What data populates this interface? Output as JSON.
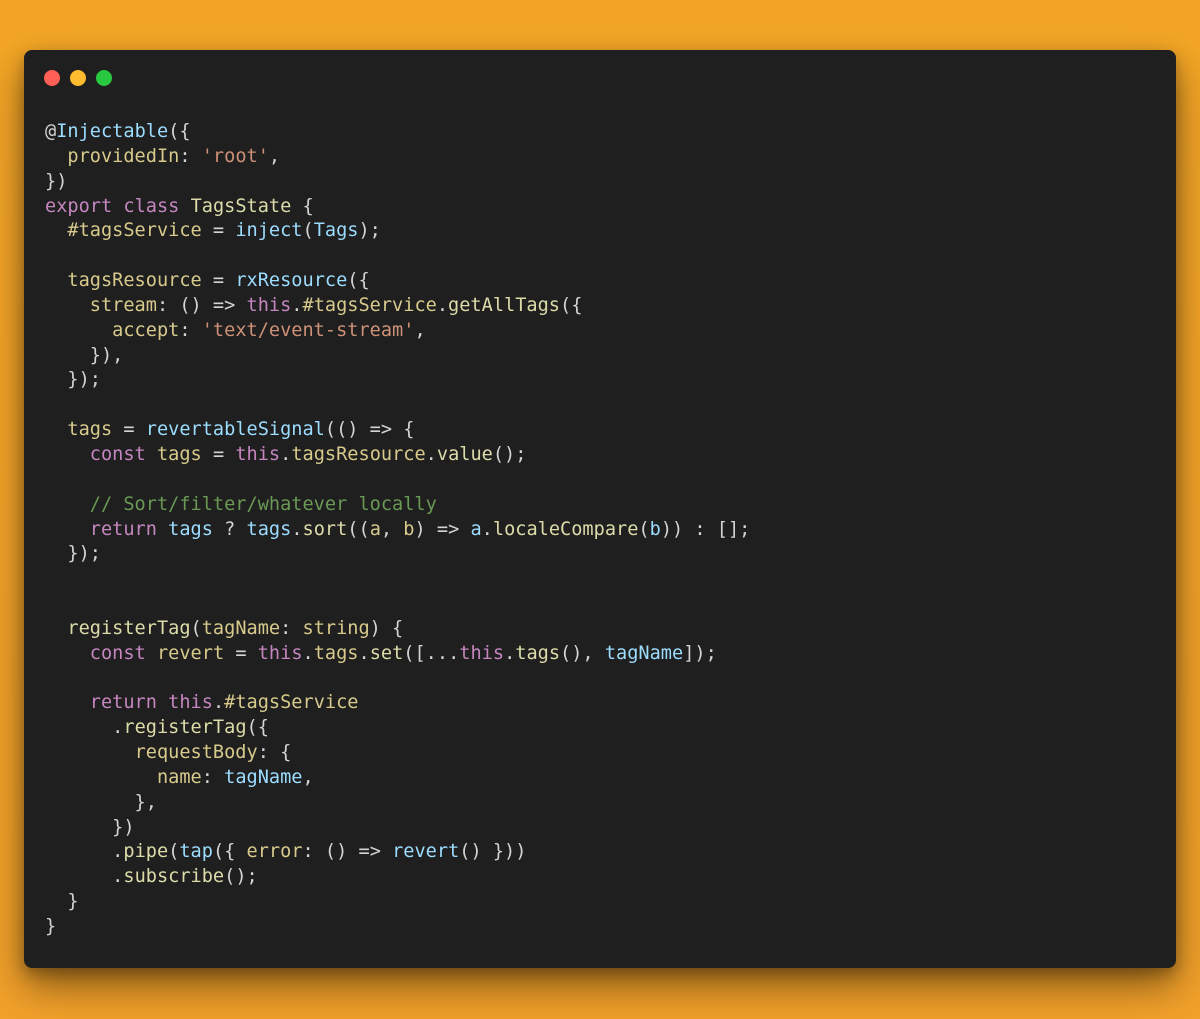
{
  "window": {
    "controls": [
      "close-icon",
      "minimize-icon",
      "maximize-icon"
    ],
    "colors": {
      "close": "#ff5f57",
      "minimize": "#febc2e",
      "maximize": "#28c840",
      "background": "#1f1f1f",
      "page": "#f3a626"
    }
  },
  "code": {
    "lines": [
      [
        [
          "plain",
          "@"
        ],
        [
          "var",
          "Injectable"
        ],
        [
          "plain",
          "({"
        ]
      ],
      [
        [
          "plain",
          "  "
        ],
        [
          "prop",
          "providedIn"
        ],
        [
          "plain",
          ": "
        ],
        [
          "string",
          "'root'"
        ],
        [
          "plain",
          ","
        ]
      ],
      [
        [
          "plain",
          "})"
        ]
      ],
      [
        [
          "keyword",
          "export"
        ],
        [
          "plain",
          " "
        ],
        [
          "keyword",
          "class"
        ],
        [
          "plain",
          " "
        ],
        [
          "fn",
          "TagsState"
        ],
        [
          "plain",
          " {"
        ]
      ],
      [
        [
          "plain",
          "  "
        ],
        [
          "prop",
          "#tagsService"
        ],
        [
          "plain",
          " = "
        ],
        [
          "var",
          "inject"
        ],
        [
          "plain",
          "("
        ],
        [
          "var",
          "Tags"
        ],
        [
          "plain",
          ");"
        ]
      ],
      [],
      [
        [
          "plain",
          "  "
        ],
        [
          "prop",
          "tagsResource"
        ],
        [
          "plain",
          " = "
        ],
        [
          "var",
          "rxResource"
        ],
        [
          "plain",
          "({"
        ]
      ],
      [
        [
          "plain",
          "    "
        ],
        [
          "prop",
          "stream"
        ],
        [
          "plain",
          ": () => "
        ],
        [
          "keyword",
          "this"
        ],
        [
          "plain",
          "."
        ],
        [
          "prop",
          "#tagsService"
        ],
        [
          "plain",
          "."
        ],
        [
          "fn",
          "getAllTags"
        ],
        [
          "plain",
          "({"
        ]
      ],
      [
        [
          "plain",
          "      "
        ],
        [
          "prop",
          "accept"
        ],
        [
          "plain",
          ": "
        ],
        [
          "string",
          "'text/event-stream'"
        ],
        [
          "plain",
          ","
        ]
      ],
      [
        [
          "plain",
          "    }),"
        ]
      ],
      [
        [
          "plain",
          "  });"
        ]
      ],
      [],
      [
        [
          "plain",
          "  "
        ],
        [
          "prop",
          "tags"
        ],
        [
          "plain",
          " = "
        ],
        [
          "var",
          "revertableSignal"
        ],
        [
          "plain",
          "(() => {"
        ]
      ],
      [
        [
          "plain",
          "    "
        ],
        [
          "keyword",
          "const"
        ],
        [
          "plain",
          " "
        ],
        [
          "prop",
          "tags"
        ],
        [
          "plain",
          " = "
        ],
        [
          "keyword",
          "this"
        ],
        [
          "plain",
          "."
        ],
        [
          "prop",
          "tagsResource"
        ],
        [
          "plain",
          "."
        ],
        [
          "fn",
          "value"
        ],
        [
          "plain",
          "();"
        ]
      ],
      [],
      [
        [
          "plain",
          "    "
        ],
        [
          "comment",
          "// Sort/filter/whatever locally"
        ]
      ],
      [
        [
          "plain",
          "    "
        ],
        [
          "keyword",
          "return"
        ],
        [
          "plain",
          " "
        ],
        [
          "var",
          "tags"
        ],
        [
          "plain",
          " ? "
        ],
        [
          "var",
          "tags"
        ],
        [
          "plain",
          "."
        ],
        [
          "fn",
          "sort"
        ],
        [
          "plain",
          "(("
        ],
        [
          "prop",
          "a"
        ],
        [
          "plain",
          ", "
        ],
        [
          "prop",
          "b"
        ],
        [
          "plain",
          ") => "
        ],
        [
          "var",
          "a"
        ],
        [
          "plain",
          "."
        ],
        [
          "fn",
          "localeCompare"
        ],
        [
          "plain",
          "("
        ],
        [
          "var",
          "b"
        ],
        [
          "plain",
          ")) : [];"
        ]
      ],
      [
        [
          "plain",
          "  });"
        ]
      ],
      [],
      [],
      [
        [
          "plain",
          "  "
        ],
        [
          "fn",
          "registerTag"
        ],
        [
          "plain",
          "("
        ],
        [
          "prop",
          "tagName"
        ],
        [
          "plain",
          ": "
        ],
        [
          "prop",
          "string"
        ],
        [
          "plain",
          ") {"
        ]
      ],
      [
        [
          "plain",
          "    "
        ],
        [
          "keyword",
          "const"
        ],
        [
          "plain",
          " "
        ],
        [
          "prop",
          "revert"
        ],
        [
          "plain",
          " = "
        ],
        [
          "keyword",
          "this"
        ],
        [
          "plain",
          "."
        ],
        [
          "prop",
          "tags"
        ],
        [
          "plain",
          "."
        ],
        [
          "fn",
          "set"
        ],
        [
          "plain",
          "([..."
        ],
        [
          "keyword",
          "this"
        ],
        [
          "plain",
          "."
        ],
        [
          "fn",
          "tags"
        ],
        [
          "plain",
          "(), "
        ],
        [
          "var",
          "tagName"
        ],
        [
          "plain",
          "]);"
        ]
      ],
      [],
      [
        [
          "plain",
          "    "
        ],
        [
          "keyword",
          "return"
        ],
        [
          "plain",
          " "
        ],
        [
          "keyword",
          "this"
        ],
        [
          "plain",
          "."
        ],
        [
          "prop",
          "#tagsService"
        ]
      ],
      [
        [
          "plain",
          "      ."
        ],
        [
          "fn",
          "registerTag"
        ],
        [
          "plain",
          "({"
        ]
      ],
      [
        [
          "plain",
          "        "
        ],
        [
          "prop",
          "requestBody"
        ],
        [
          "plain",
          ": {"
        ]
      ],
      [
        [
          "plain",
          "          "
        ],
        [
          "prop",
          "name"
        ],
        [
          "plain",
          ": "
        ],
        [
          "var",
          "tagName"
        ],
        [
          "plain",
          ","
        ]
      ],
      [
        [
          "plain",
          "        },"
        ]
      ],
      [
        [
          "plain",
          "      })"
        ]
      ],
      [
        [
          "plain",
          "      ."
        ],
        [
          "fn",
          "pipe"
        ],
        [
          "plain",
          "("
        ],
        [
          "var",
          "tap"
        ],
        [
          "plain",
          "({ "
        ],
        [
          "prop",
          "error"
        ],
        [
          "plain",
          ": () => "
        ],
        [
          "var",
          "revert"
        ],
        [
          "plain",
          "() }))"
        ]
      ],
      [
        [
          "plain",
          "      ."
        ],
        [
          "fn",
          "subscribe"
        ],
        [
          "plain",
          "();"
        ]
      ],
      [
        [
          "plain",
          "  }"
        ]
      ],
      [
        [
          "plain",
          "}"
        ]
      ]
    ]
  }
}
